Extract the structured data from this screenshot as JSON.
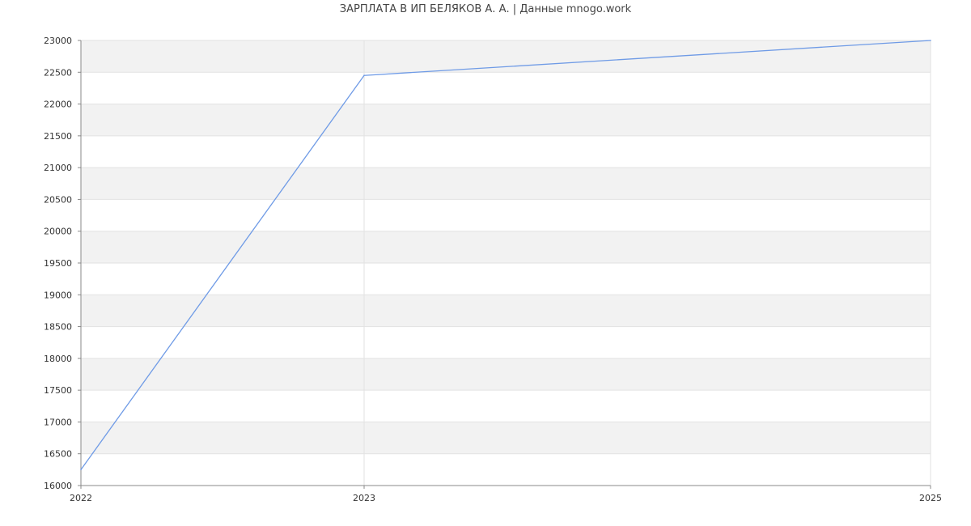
{
  "chart_data": {
    "type": "line",
    "title": "ЗАРПЛАТА В ИП БЕЛЯКОВ А. А. | Данные mnogo.work",
    "x": [
      "2022",
      "2023",
      "2025"
    ],
    "y_ticks": [
      16000,
      16500,
      17000,
      17500,
      18000,
      18500,
      19000,
      19500,
      20000,
      20500,
      21000,
      21500,
      22000,
      22500,
      23000
    ],
    "ylim": [
      16000,
      23000
    ],
    "series": [
      {
        "values": [
          16250,
          22450,
          23000
        ]
      }
    ],
    "grid": true,
    "xlabel": "",
    "ylabel": "",
    "colors": {
      "line": "#6f9be6",
      "band": "#f2f2f2",
      "grid": "#e2e2e2",
      "axis": "#888888",
      "text": "#333333"
    }
  }
}
